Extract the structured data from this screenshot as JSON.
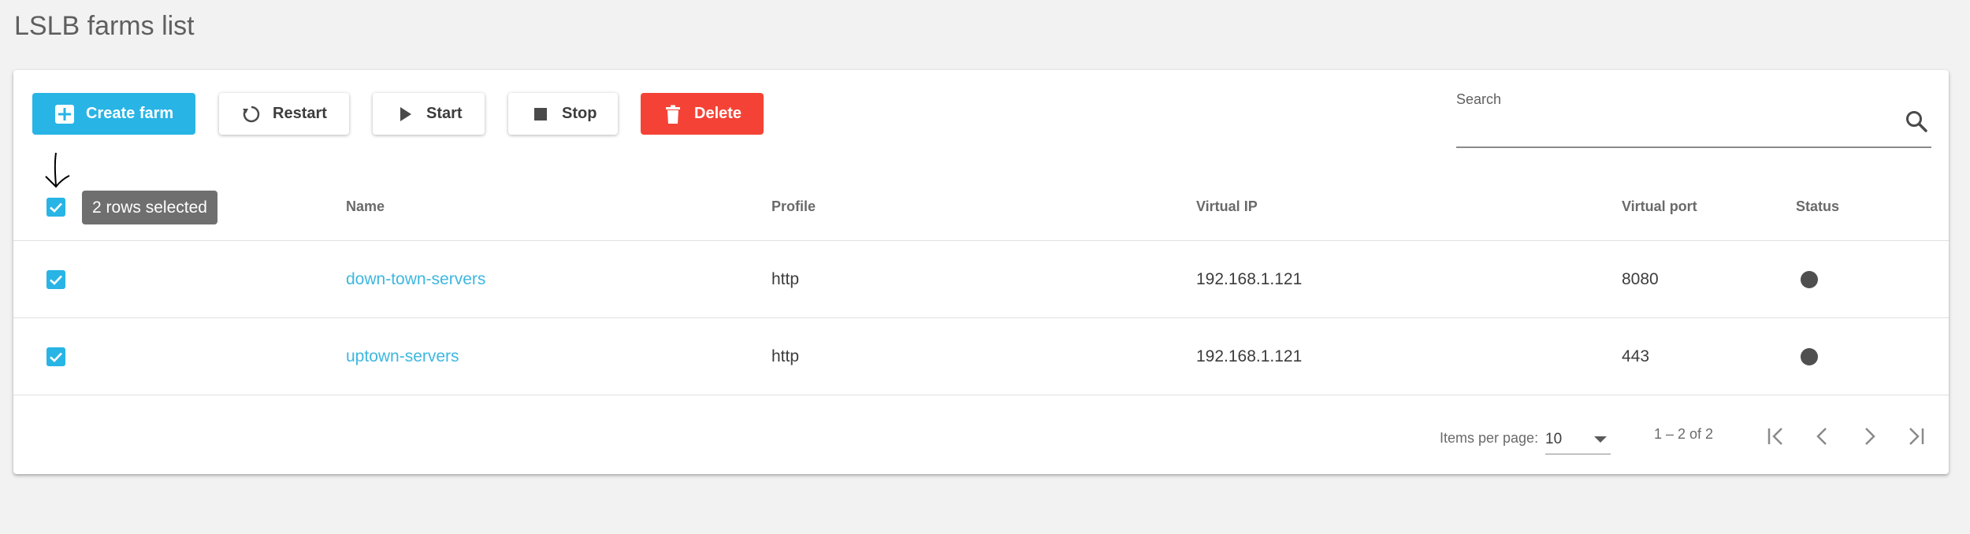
{
  "page": {
    "title": "LSLB farms list"
  },
  "toolbar": {
    "create_label": "Create farm",
    "restart_label": "Restart",
    "start_label": "Start",
    "stop_label": "Stop",
    "delete_label": "Delete"
  },
  "search": {
    "label": "Search",
    "value": "",
    "placeholder": ""
  },
  "selection": {
    "tooltip": "2 rows selected",
    "all_checked": true
  },
  "table": {
    "columns": [
      "Name",
      "Profile",
      "Virtual IP",
      "Virtual port",
      "Status"
    ],
    "rows": [
      {
        "checked": true,
        "name": "down-town-servers",
        "profile": "http",
        "vip": "192.168.1.121",
        "vport": "8080",
        "status": "dark-dot"
      },
      {
        "checked": true,
        "name": "uptown-servers",
        "profile": "http",
        "vip": "192.168.1.121",
        "vport": "443",
        "status": "dark-dot"
      }
    ]
  },
  "pagination": {
    "items_per_page_label": "Items per page:",
    "items_per_page_value": "10",
    "range": "1 – 2 of 2"
  },
  "colors": {
    "accent": "#28b4e5",
    "link": "#3eb7df",
    "danger": "#f44336",
    "status_dot": "#4f4f4f"
  }
}
